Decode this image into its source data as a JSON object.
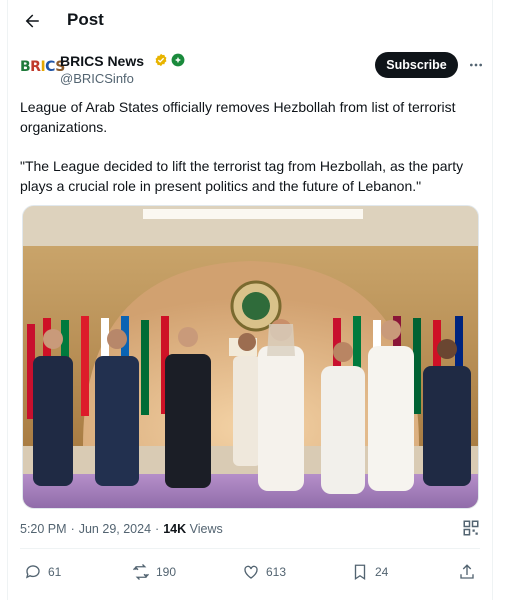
{
  "header": {
    "title": "Post",
    "back_icon": "arrow-left-icon"
  },
  "author": {
    "logo_text": "BRICS",
    "display_name": "BRICS News",
    "handle": "@BRICSinfo",
    "subscribe_label": "Subscribe",
    "more_icon": "more-horizontal-icon"
  },
  "post": {
    "paragraph_1": "League of Arab States officially removes Hezbollah from list of terrorist organizations.",
    "paragraph_2": "\"The League decided to lift the terrorist tag from Hezbollah, as the party plays a crucial role in present politics and the future of Lebanon.\""
  },
  "meta": {
    "time": "5:20 PM",
    "date": "Jun 29, 2024",
    "views_count": "14K",
    "views_label": "Views"
  },
  "actions": {
    "replies": "61",
    "reposts": "190",
    "likes": "613",
    "bookmarks": "24"
  },
  "colors": {
    "accent": "#1d9bf0",
    "text_primary": "#0f1419",
    "text_secondary": "#536471",
    "verified_gold": "#e8b400"
  }
}
